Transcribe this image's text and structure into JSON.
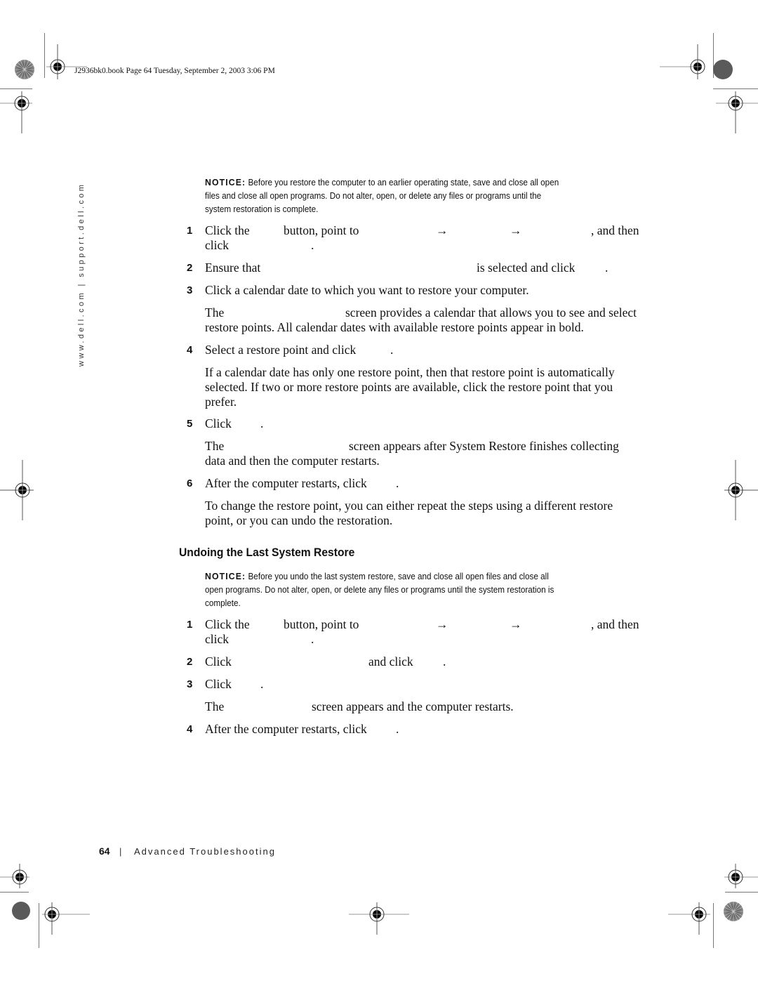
{
  "header": {
    "file_info": "J2936bk0.book  Page 64  Tuesday, September 2, 2003  3:06 PM"
  },
  "side_margin": {
    "url_text": "www.dell.com | support.dell.com"
  },
  "section1": {
    "notice_label": "NOTICE:",
    "notice_lines": [
      "Before you restore the computer to an earlier operating state, save and close all open",
      "files and close all open programs. Do not alter, open, or delete any files or programs until the",
      "system restoration is complete."
    ],
    "steps": [
      {
        "number": "1",
        "parts": [
          "Click the",
          "button, point to",
          "→",
          "→",
          ", and then",
          "click",
          "."
        ]
      },
      {
        "number": "2",
        "parts": [
          "Ensure that",
          "is selected and click",
          "."
        ]
      },
      {
        "number": "3",
        "parts": [
          "Click a calendar date to which you want to restore your computer."
        ],
        "note_lines": [
          [
            "The",
            "screen provides a calendar that allows you to see and select"
          ],
          [
            "restore points. All calendar dates with available restore points appear in bold."
          ]
        ]
      },
      {
        "number": "4",
        "parts": [
          "Select a restore point and click",
          "."
        ],
        "note_lines": [
          [
            "If a calendar date has only one restore point, then that restore point is automatically"
          ],
          [
            "selected. If two or more restore points are available, click the restore point that you"
          ],
          [
            "prefer."
          ]
        ]
      },
      {
        "number": "5",
        "parts": [
          "Click",
          "."
        ],
        "note_lines": [
          [
            "The",
            "screen appears after System Restore finishes collecting"
          ],
          [
            "data and then the computer restarts."
          ]
        ]
      },
      {
        "number": "6",
        "parts": [
          "After the computer restarts, click",
          "."
        ],
        "note_lines": [
          [
            "To change the restore point, you can either repeat the steps using a different restore"
          ],
          [
            "point, or you can undo the restoration."
          ]
        ]
      }
    ]
  },
  "section2": {
    "heading": "Undoing the Last System Restore",
    "notice_label": "NOTICE:",
    "notice_lines": [
      "Before you undo the last system restore, save and close all open files and close all",
      "open programs. Do not alter, open, or delete any files or programs until the system restoration is",
      "complete."
    ],
    "steps": [
      {
        "number": "1",
        "parts": [
          "Click the",
          "button, point to",
          "→",
          "→",
          ", and then",
          "click",
          "."
        ]
      },
      {
        "number": "2",
        "parts": [
          "Click",
          "and click",
          "."
        ]
      },
      {
        "number": "3",
        "parts": [
          "Click",
          "."
        ],
        "note_lines": [
          [
            "The",
            "screen appears and the computer restarts."
          ]
        ]
      },
      {
        "number": "4",
        "parts": [
          "After the computer restarts, click",
          "."
        ]
      }
    ]
  },
  "footer": {
    "page_number": "64",
    "separator": "|",
    "chapter_title": "Advanced Troubleshooting"
  }
}
